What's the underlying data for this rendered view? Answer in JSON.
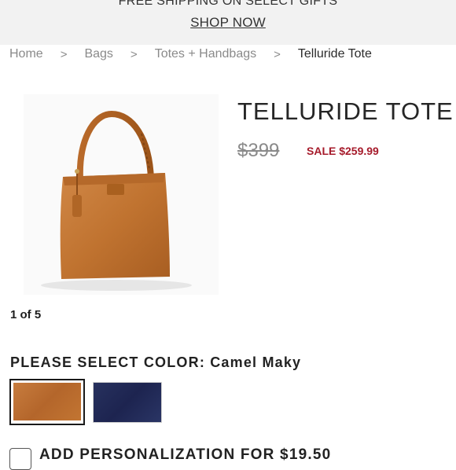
{
  "promo": {
    "text": "FREE SHIPPING ON SELECT GIFTS",
    "link": "SHOP NOW"
  },
  "breadcrumb": {
    "items": [
      "Home",
      "Bags",
      "Totes + Handbags",
      "Telluride Tote"
    ],
    "separator": ">"
  },
  "product": {
    "title": "TELLURIDE TOTE",
    "original_price": "$399",
    "sale_price": "SALE $259.99",
    "gallery_count": "1 of 5",
    "color_label": "PLEASE SELECT COLOR: Camel Maky",
    "swatches": [
      {
        "color": "#b96a2f",
        "selected": true
      },
      {
        "color": "#232b57",
        "selected": false
      }
    ],
    "personalize_label": "ADD PERSONALIZATION FOR $19.50"
  },
  "colors": {
    "accent": "#a61b2b",
    "promo_bg": "#f2f2f2"
  }
}
